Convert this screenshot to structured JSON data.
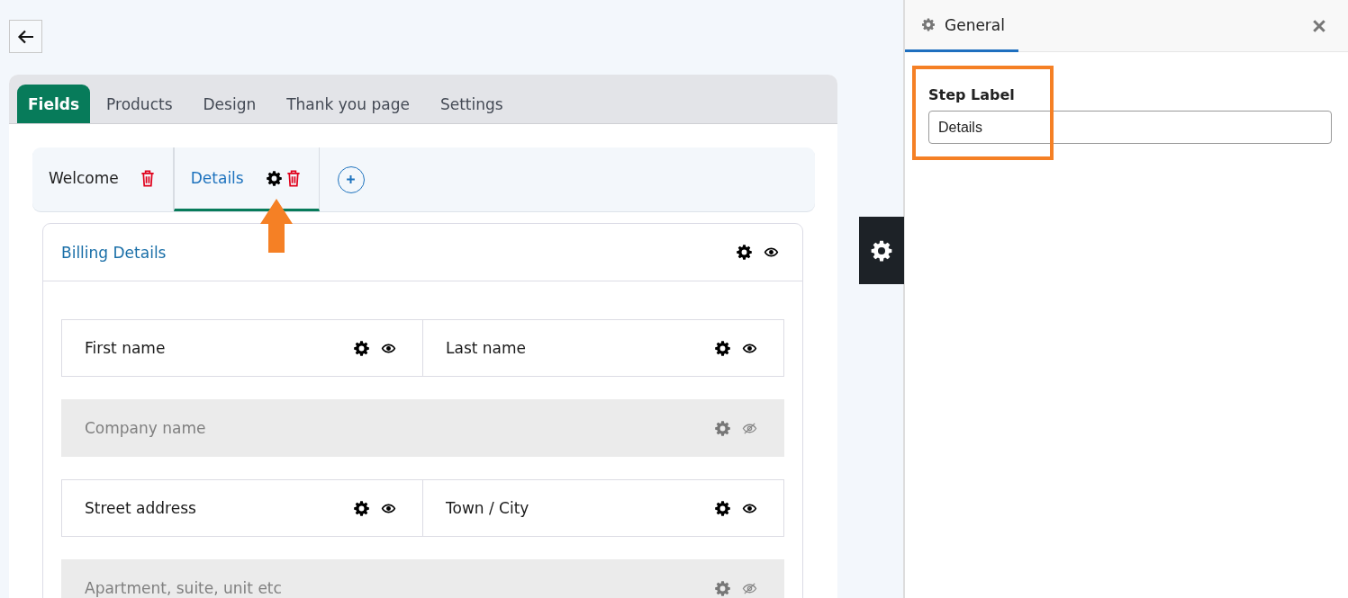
{
  "main_tabs": [
    {
      "label": "Fields",
      "selected": true
    },
    {
      "label": "Products",
      "selected": false
    },
    {
      "label": "Design",
      "selected": false
    },
    {
      "label": "Thank you page",
      "selected": false
    },
    {
      "label": "Settings",
      "selected": false
    }
  ],
  "steps": [
    {
      "label": "Welcome",
      "selected": false,
      "settings_icon": false
    },
    {
      "label": "Details",
      "selected": true,
      "settings_icon": true
    }
  ],
  "section": {
    "title": "Billing Details",
    "visible": true
  },
  "rows": [
    {
      "fields": [
        {
          "label": "First name",
          "visible": true
        },
        {
          "label": "Last name",
          "visible": true
        }
      ]
    },
    {
      "fields": [
        {
          "label": "Company name",
          "visible": false
        }
      ]
    },
    {
      "fields": [
        {
          "label": "Street address",
          "visible": true
        },
        {
          "label": "Town / City",
          "visible": true
        }
      ]
    },
    {
      "fields": [
        {
          "label": "Apartment, suite, unit etc",
          "visible": false
        }
      ]
    }
  ],
  "panel": {
    "tab": "General",
    "field_label": "Step Label",
    "field_value": "Details"
  }
}
